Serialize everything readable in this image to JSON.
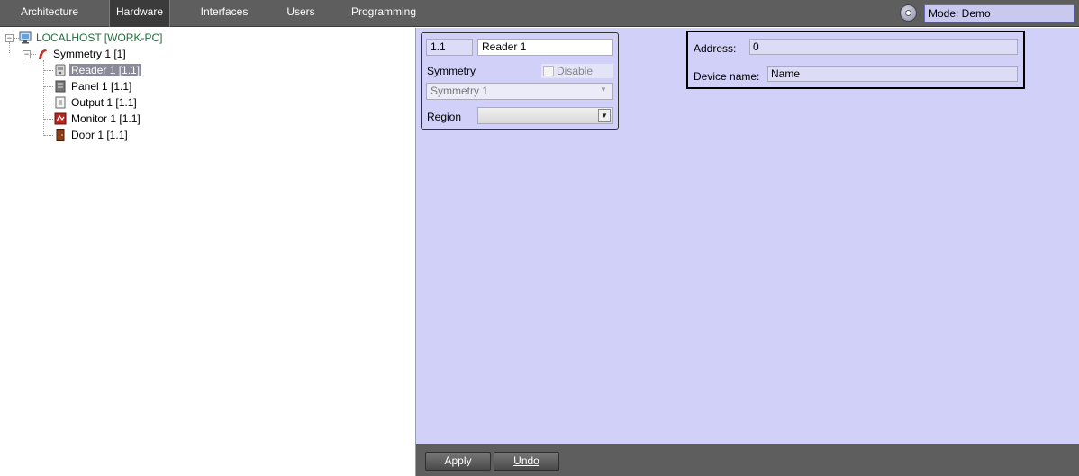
{
  "tabs": [
    {
      "label": "Architecture",
      "active": false
    },
    {
      "label": "Hardware",
      "active": true
    },
    {
      "label": "Interfaces",
      "active": false
    },
    {
      "label": "Users",
      "active": false
    },
    {
      "label": "Programming",
      "active": false
    }
  ],
  "mode": {
    "text": "Mode: Demo"
  },
  "tree": {
    "host": "LOCALHOST [WORK-PC]",
    "symmetry": "Symmetry 1 [1]",
    "children": [
      {
        "label": "Reader 1 [1.1]",
        "icon": "reader-icon",
        "selected": true
      },
      {
        "label": "Panel 1 [1.1]",
        "icon": "panel-icon",
        "selected": false
      },
      {
        "label": "Output 1 [1.1]",
        "icon": "output-icon",
        "selected": false
      },
      {
        "label": "Monitor 1 [1.1]",
        "icon": "monitor-icon",
        "selected": false
      },
      {
        "label": "Door 1 [1.1]",
        "icon": "door-icon",
        "selected": false
      }
    ]
  },
  "object_card": {
    "id": "1.1",
    "name": "Reader 1",
    "parent_label": "Symmetry",
    "disable_label": "Disable",
    "parent_value": "Symmetry 1",
    "region_label": "Region",
    "region_value": ""
  },
  "settings": {
    "address_label": "Address:",
    "address_value": "0",
    "device_name_label": "Device name:",
    "device_name_value": "Name"
  },
  "buttons": {
    "apply": "Apply",
    "undo": "Undo"
  },
  "colors": {
    "toolbar": "#5e5e5e",
    "panel_bg": "#d0d0f8",
    "selected_bg": "#8a8a9a",
    "host_text": "#1e6e3a"
  }
}
